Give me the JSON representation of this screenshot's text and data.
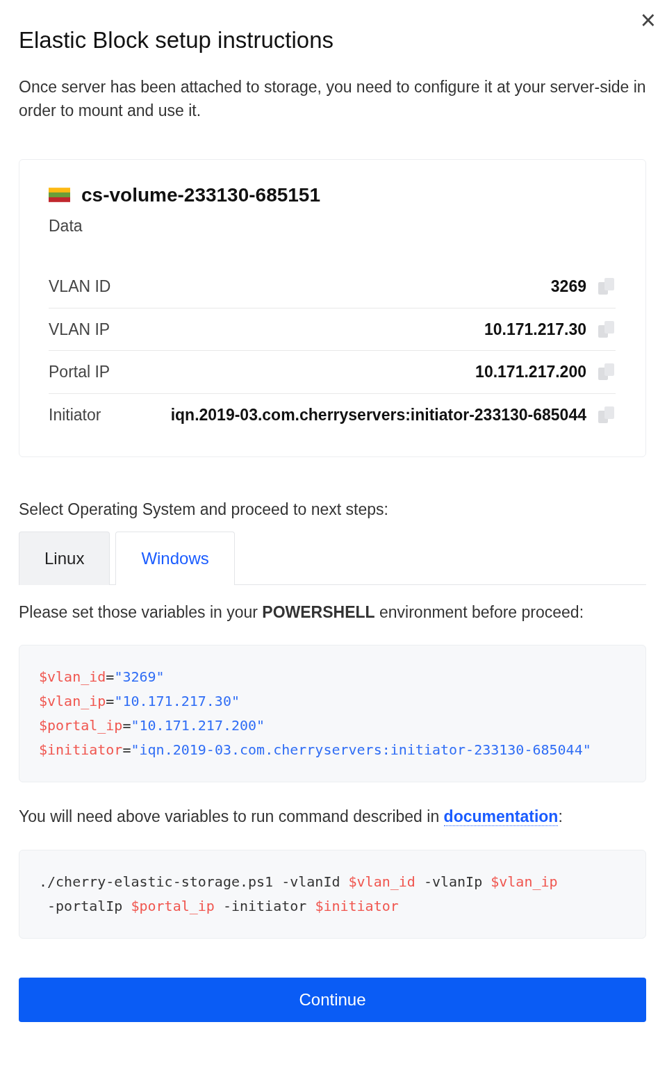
{
  "dialog": {
    "title": "Elastic Block setup instructions",
    "close": "×",
    "intro": "Once server has been attached to storage, you need to configure it at your server-side in order to mount and use it."
  },
  "volume": {
    "name": "cs-volume-233130-685151",
    "subtitle": "Data",
    "details": [
      {
        "label": "VLAN ID",
        "value": "3269"
      },
      {
        "label": "VLAN IP",
        "value": "10.171.217.30"
      },
      {
        "label": "Portal IP",
        "value": "10.171.217.200"
      },
      {
        "label": "Initiator",
        "value": "iqn.2019-03.com.cherryservers:initiator-233130-685044"
      }
    ]
  },
  "os_prompt": "Select Operating System and proceed to next steps:",
  "tabs": [
    {
      "label": "Linux",
      "selected": false
    },
    {
      "label": "Windows",
      "selected": true
    }
  ],
  "variables_note": "Please set those variables in your **POWERSHELL** environment before proceed:",
  "variables_code": [
    [
      {
        "kind": "var",
        "text": "$vlan_id"
      },
      {
        "kind": "plain",
        "text": "="
      },
      {
        "kind": "str",
        "text": "\"3269\""
      }
    ],
    [
      {
        "kind": "var",
        "text": "$vlan_ip"
      },
      {
        "kind": "plain",
        "text": "="
      },
      {
        "kind": "str",
        "text": "\"10.171.217.30\""
      }
    ],
    [
      {
        "kind": "var",
        "text": "$portal_ip"
      },
      {
        "kind": "plain",
        "text": "="
      },
      {
        "kind": "str",
        "text": "\"10.171.217.200\""
      }
    ],
    [
      {
        "kind": "var",
        "text": "$initiator"
      },
      {
        "kind": "plain",
        "text": "="
      },
      {
        "kind": "str",
        "text": "\"iqn.2019-03.com.cherryservers:initiator-233130-685044\""
      }
    ]
  ],
  "command_note": {
    "before": "You will need above variables to run command described in ",
    "link": "documentation",
    "after": ":"
  },
  "command_code": [
    [
      {
        "kind": "plain",
        "text": "./cherry-elastic-storage.ps1 -vlanId "
      },
      {
        "kind": "var",
        "text": "$vlan_id"
      },
      {
        "kind": "plain",
        "text": " -vlanIp "
      },
      {
        "kind": "var",
        "text": "$vlan_ip"
      }
    ],
    [
      {
        "kind": "plain",
        "text": " -portalIp "
      },
      {
        "kind": "var",
        "text": "$portal_ip"
      },
      {
        "kind": "plain",
        "text": " -initiator "
      },
      {
        "kind": "var",
        "text": "$initiator"
      }
    ]
  ],
  "continue_button": "Continue"
}
